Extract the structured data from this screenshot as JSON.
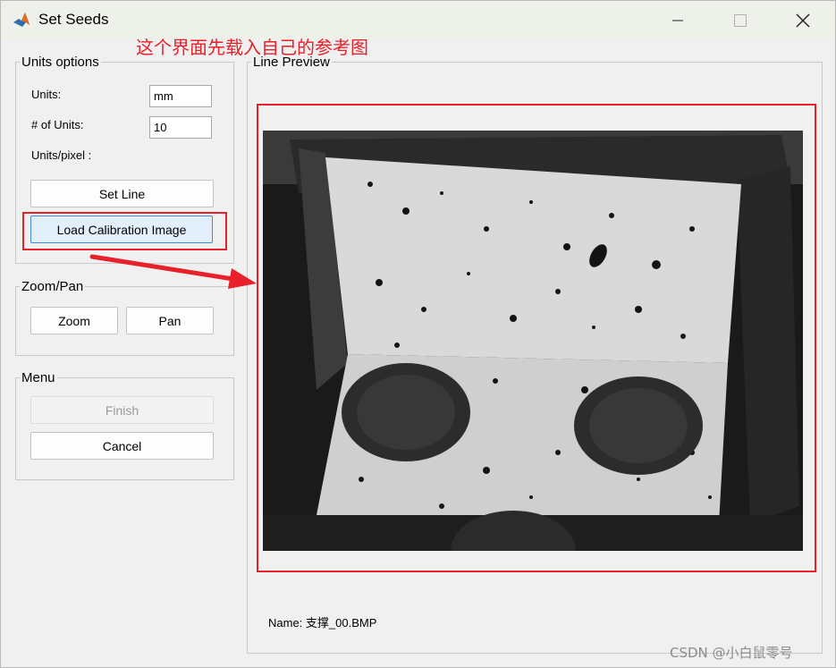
{
  "window": {
    "title": "Set Seeds",
    "icon": "matlab-logo-icon",
    "controls": [
      "minimize-icon",
      "maximize-icon",
      "close-icon"
    ]
  },
  "annotation": {
    "text": "这个界面先载入自己的参考图",
    "color": "#e8202a"
  },
  "units_options": {
    "legend": "Units options",
    "units_label": "Units:",
    "units_value": "mm",
    "num_units_label": "# of Units:",
    "num_units_value": "10",
    "units_per_pixel_label": "Units/pixel :",
    "set_line_label": "Set Line",
    "load_calibration_label": "Load Calibration Image"
  },
  "zoom_pan": {
    "legend": "Zoom/Pan",
    "zoom_label": "Zoom",
    "pan_label": "Pan"
  },
  "menu": {
    "legend": "Menu",
    "finish_label": "Finish",
    "cancel_label": "Cancel"
  },
  "preview": {
    "legend": "Line Preview",
    "name_label": "Name: 支撑_00.BMP"
  },
  "watermark": "CSDN @小白鼠零号",
  "colors": {
    "accent_red": "#e8202a",
    "focus_blue": "#3d8ee0",
    "background": "#f0f0f0"
  }
}
